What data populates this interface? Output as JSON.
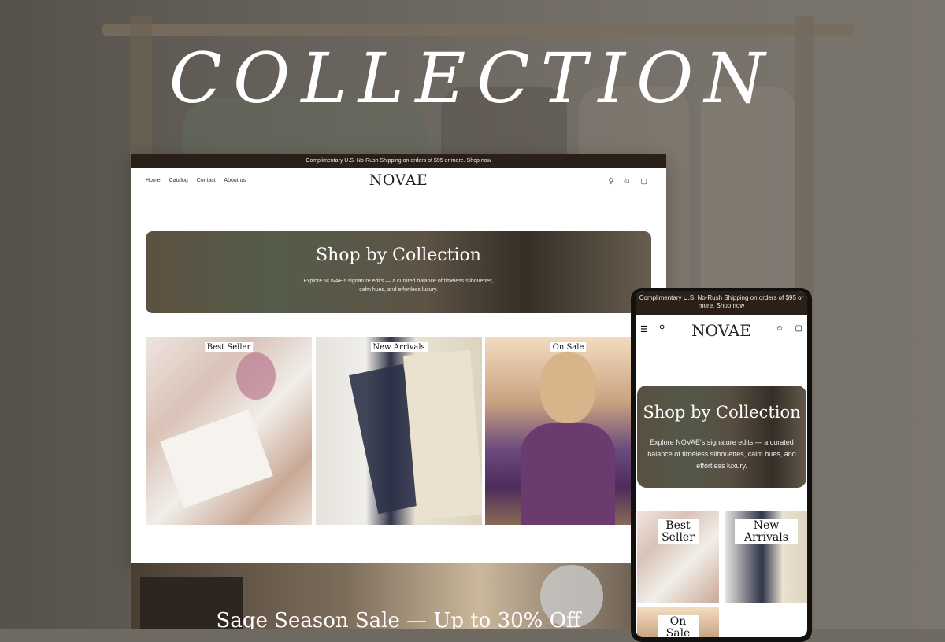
{
  "hero": {
    "title": "COLLECTION"
  },
  "desktop": {
    "announcement": "Complimentary U.S. No-Rush Shipping on orders of $95 or more. Shop now",
    "nav": {
      "links": [
        "Home",
        "Catalog",
        "Contact",
        "About us"
      ]
    },
    "logo": "NOVAE",
    "icons": [
      "search-icon",
      "account-icon",
      "cart-icon"
    ],
    "banner": {
      "title": "Shop by Collection",
      "description": "Explore NOVAE's signature edits — a curated balance of timeless silhouettes, calm hues, and effortless luxury."
    },
    "collections": [
      "Best Seller",
      "New Arrivals",
      "On Sale"
    ],
    "sale": {
      "title": "Sage Season Sale — Up to 30% Off"
    }
  },
  "mobile": {
    "announcement": "Complimentary U.S. No-Rush Shipping on orders of $95 or more. Shop now",
    "logo": "NOVAE",
    "icons": [
      "menu-icon",
      "search-icon",
      "account-icon",
      "cart-icon"
    ],
    "banner": {
      "title": "Shop by Collection",
      "description": "Explore NOVAE's signature edits — a curated balance of timeless silhouettes, calm hues, and effortless luxury."
    },
    "collections": [
      "Best Seller",
      "New Arrivals",
      "On Sale"
    ]
  },
  "colors": {
    "announcement_bg": "#2a2018",
    "accent": "#ffffff"
  }
}
